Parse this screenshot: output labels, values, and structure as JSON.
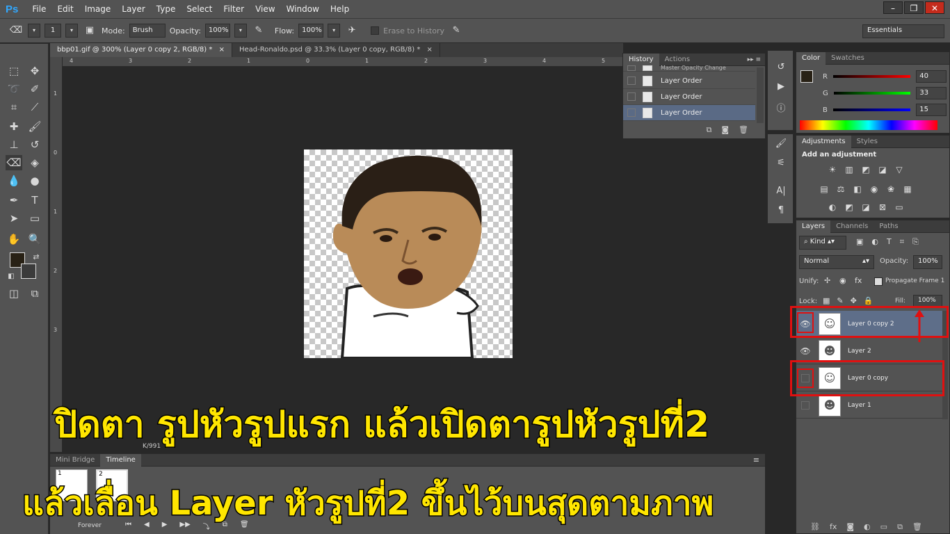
{
  "app": {
    "logo": "Ps"
  },
  "menu": [
    "File",
    "Edit",
    "Image",
    "Layer",
    "Type",
    "Select",
    "Filter",
    "View",
    "Window",
    "Help"
  ],
  "options": {
    "brush_size": "1",
    "mode_label": "Mode:",
    "mode_value": "Brush",
    "opacity_label": "Opacity:",
    "opacity_value": "100%",
    "flow_label": "Flow:",
    "flow_value": "100%",
    "erase_history": "Erase to History",
    "workspace": "Essentials"
  },
  "tabs": [
    {
      "label": "bbp01.gif @ 300% (Layer 0 copy 2, RGB/8) *",
      "close": "×",
      "active": true
    },
    {
      "label": "Head-Ronaldo.psd @ 33.3% (Layer 0 copy, RGB/8) *",
      "close": "×",
      "active": false
    }
  ],
  "ruler": {
    "h": [
      "4",
      "3",
      "2",
      "1",
      "0",
      "1",
      "2",
      "3",
      "4",
      "5"
    ],
    "v": [
      "1",
      "0",
      "1",
      "2",
      "3"
    ]
  },
  "history": {
    "tabs": [
      "History",
      "Actions"
    ],
    "rows": [
      {
        "label": "Master Opacity Change"
      },
      {
        "label": "Layer Order"
      },
      {
        "label": "Layer Order"
      },
      {
        "label": "Layer Order",
        "selected": true
      }
    ]
  },
  "color": {
    "tabs": [
      "Color",
      "Swatches"
    ],
    "r_label": "R",
    "r": "40",
    "g_label": "G",
    "g": "33",
    "b_label": "B",
    "b": "15",
    "fg": "#282115",
    "bg": "#3b3b3b"
  },
  "adjustments": {
    "tabs": [
      "Adjustments",
      "Styles"
    ],
    "title": "Add an adjustment"
  },
  "layers": {
    "tabs": [
      "Layers",
      "Channels",
      "Paths"
    ],
    "kind": "Kind",
    "blend": "Normal",
    "opacity_label": "Opacity:",
    "opacity": "100%",
    "unify_label": "Unify:",
    "propagate": "Propagate Frame 1",
    "lock_label": "Lock:",
    "fill_label": "Fill:",
    "fill": "100%",
    "rows": [
      {
        "name": "Layer 0 copy 2",
        "visible": true,
        "selected": true
      },
      {
        "name": "Layer 2",
        "visible": true,
        "selected": false
      },
      {
        "name": "Layer 0 copy",
        "visible": false,
        "selected": false
      },
      {
        "name": "Layer 1",
        "visible": false,
        "selected": false
      }
    ]
  },
  "timeline": {
    "tabs": [
      "Mini Bridge",
      "Timeline"
    ],
    "frames": [
      "1",
      "2"
    ],
    "loop": "Forever",
    "frame_delay": "K/991"
  },
  "captions": {
    "line1": "ปิดตา รูปหัวรูปแรก แล้วเปิดตารูปหัวรูปที่2",
    "line2": "แล้วเลื่อน Layer หัวรูปที่2 ขึ้นไว้บนสุดตามภาพ"
  }
}
